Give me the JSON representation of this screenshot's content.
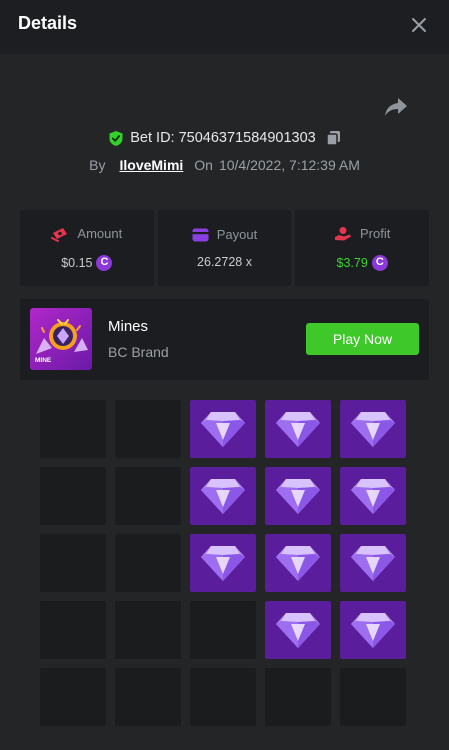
{
  "header": {
    "title": "Details",
    "close_icon": "close-icon"
  },
  "share_icon": "share-arrow-icon",
  "bet": {
    "id_label": "Bet ID: 75046371584901303",
    "verified_icon": "shield-check-icon",
    "copy_icon": "copy-icon"
  },
  "byline": {
    "by_label": "By",
    "username": "IloveMimi",
    "on_label": "On",
    "datetime": "10/4/2022, 7:12:39 AM"
  },
  "stats": [
    {
      "label": "Amount",
      "value": "$0.15",
      "icon": "money-icon",
      "coin": true
    },
    {
      "label": "Payout",
      "value": "26.2728 x",
      "icon": "card-icon",
      "coin": false
    },
    {
      "label": "Profit",
      "value": "$3.79",
      "icon": "profit-hand-icon",
      "coin": true
    }
  ],
  "coin_symbol": "C",
  "game": {
    "name": "Mines",
    "brand": "BC Brand",
    "thumb_label": "MINE",
    "play_label": "Play Now"
  },
  "board": [
    [
      0,
      0,
      1,
      1,
      1
    ],
    [
      0,
      0,
      1,
      1,
      1
    ],
    [
      0,
      0,
      1,
      1,
      1
    ],
    [
      0,
      0,
      0,
      1,
      1
    ],
    [
      0,
      0,
      0,
      0,
      0
    ]
  ],
  "colors": {
    "background": "#232527",
    "header": "#1c1e21",
    "card": "#1b1d20",
    "accent_green": "#3ec82a",
    "profit_green": "#3dd62f",
    "gem_tile": "#5a1d9c",
    "empty_tile": "#1b1c1e",
    "coin": "#8c38d9"
  }
}
